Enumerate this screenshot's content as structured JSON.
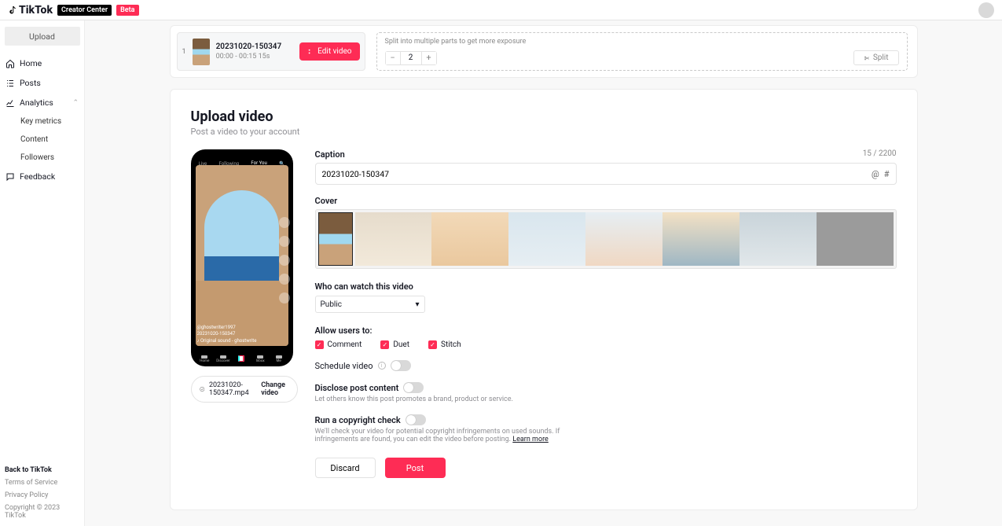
{
  "topbar": {
    "brand": "TikTok",
    "creator_center": "Creator Center",
    "beta": "Beta"
  },
  "sidebar": {
    "upload": "Upload",
    "home": "Home",
    "posts": "Posts",
    "analytics": "Analytics",
    "key_metrics": "Key metrics",
    "content": "Content",
    "followers": "Followers",
    "feedback": "Feedback",
    "back": "Back to TikTok",
    "terms": "Terms of Service",
    "privacy": "Privacy Policy",
    "copyright": "Copyright © 2023 TikTok"
  },
  "clip": {
    "index": "1",
    "title": "20231020-150347",
    "meta": "00:00 - 00:15   15s",
    "edit": "Edit video"
  },
  "split": {
    "hint": "Split into multiple parts to get more exposure",
    "value": "2",
    "button": "Split"
  },
  "upload": {
    "title": "Upload video",
    "subtitle": "Post a video to your account",
    "caption_label": "Caption",
    "caption_count": "15 / 2200",
    "caption_value": "20231020-150347",
    "cover_label": "Cover",
    "who_label": "Who can watch this video",
    "who_value": "Public",
    "allow_label": "Allow users to:",
    "comment": "Comment",
    "duet": "Duet",
    "stitch": "Stitch",
    "schedule": "Schedule video",
    "disclose": "Disclose post content",
    "disclose_help": "Let others know this post promotes a brand, product or service.",
    "copyright": "Run a copyright check",
    "copyright_help": "We'll check your video for potential copyright infringements on used sounds. If infringements are found, you can edit the video before posting. ",
    "learn_more": "Learn more",
    "discard": "Discard",
    "post": "Post",
    "filename": "20231020-150347.mp4",
    "change": "Change video",
    "phone": {
      "live": "Live",
      "following": "Following",
      "foryou": "For You",
      "user": "@ghostwriter1997",
      "desc": "20231020-150347",
      "sound": "♪ Original sound - ghostwrite",
      "nav": [
        "Home",
        "Discover",
        "",
        "Inbox",
        "Me"
      ]
    }
  }
}
